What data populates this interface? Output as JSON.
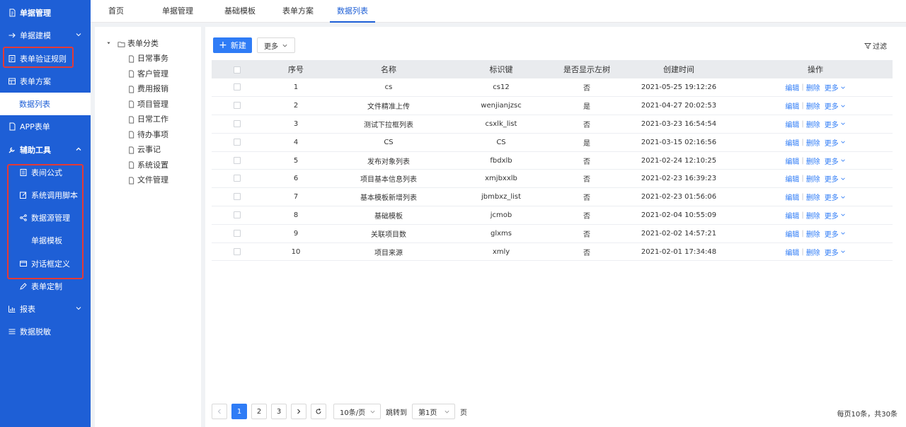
{
  "sidebar": {
    "items": [
      {
        "label": "单据管理",
        "icon": "document-icon"
      },
      {
        "label": "单据建模",
        "icon": "arrow-right-icon"
      },
      {
        "label": "表单验证规则",
        "icon": "checklist-icon"
      },
      {
        "label": "表单方案",
        "icon": "layout-icon"
      },
      {
        "label": "数据列表"
      },
      {
        "label": "APP表单",
        "icon": "mobile-doc-icon"
      },
      {
        "label": "辅助工具",
        "icon": "wrench-icon"
      },
      {
        "label": "表间公式",
        "icon": "formula-icon"
      },
      {
        "label": "系统调用脚本",
        "icon": "edit-icon"
      },
      {
        "label": "数据源管理",
        "icon": "share-icon"
      },
      {
        "label": "单据模板"
      },
      {
        "label": "对话框定义",
        "icon": "dialog-icon"
      },
      {
        "label": "表单定制",
        "icon": "pen-icon"
      },
      {
        "label": "报表",
        "icon": "chart-icon"
      },
      {
        "label": "数据脱敏",
        "icon": "list-icon"
      }
    ]
  },
  "tabs": [
    {
      "label": "首页"
    },
    {
      "label": "单据管理"
    },
    {
      "label": "基础模板"
    },
    {
      "label": "表单方案"
    },
    {
      "label": "数据列表"
    }
  ],
  "tree": {
    "root": "表单分类",
    "children": [
      "日常事务",
      "客户管理",
      "费用报销",
      "项目管理",
      "日常工作",
      "待办事项",
      "云事记",
      "系统设置",
      "文件管理"
    ]
  },
  "toolbar": {
    "new_label": "新建",
    "more_label": "更多",
    "filter_label": "过滤"
  },
  "table": {
    "headers": [
      "序号",
      "名称",
      "标识键",
      "是否显示左树",
      "创建时间",
      "操作"
    ],
    "ops": {
      "edit": "编辑",
      "delete": "删除",
      "more": "更多"
    },
    "rows": [
      {
        "no": "1",
        "name": "cs",
        "key": "cs12",
        "tree": "否",
        "time": "2021-05-25 19:12:26"
      },
      {
        "no": "2",
        "name": "文件精准上传",
        "key": "wenjianjzsc",
        "tree": "是",
        "time": "2021-04-27 20:02:53"
      },
      {
        "no": "3",
        "name": "测试下拉框列表",
        "key": "csxlk_list",
        "tree": "否",
        "time": "2021-03-23 16:54:54"
      },
      {
        "no": "4",
        "name": "CS",
        "key": "CS",
        "tree": "是",
        "time": "2021-03-15 02:16:56"
      },
      {
        "no": "5",
        "name": "发布对象列表",
        "key": "fbdxlb",
        "tree": "否",
        "time": "2021-02-24 12:10:25"
      },
      {
        "no": "6",
        "name": "项目基本信息列表",
        "key": "xmjbxxlb",
        "tree": "否",
        "time": "2021-02-23 16:39:23"
      },
      {
        "no": "7",
        "name": "基本模板新增列表",
        "key": "jbmbxz_list",
        "tree": "否",
        "time": "2021-02-23 01:56:06"
      },
      {
        "no": "8",
        "name": "基础模板",
        "key": "jcmob",
        "tree": "否",
        "time": "2021-02-04 10:55:09"
      },
      {
        "no": "9",
        "name": "关联项目数",
        "key": "glxms",
        "tree": "否",
        "time": "2021-02-02 14:57:21"
      },
      {
        "no": "10",
        "name": "项目来源",
        "key": "xmly",
        "tree": "否",
        "time": "2021-02-01 17:34:48"
      }
    ]
  },
  "pager": {
    "pages": [
      "1",
      "2",
      "3"
    ],
    "current": "1",
    "page_size": "10条/页",
    "jump_label": "跳转到",
    "jump_value": "第1页",
    "page_suffix": "页",
    "summary": "每页10条，共30条"
  }
}
